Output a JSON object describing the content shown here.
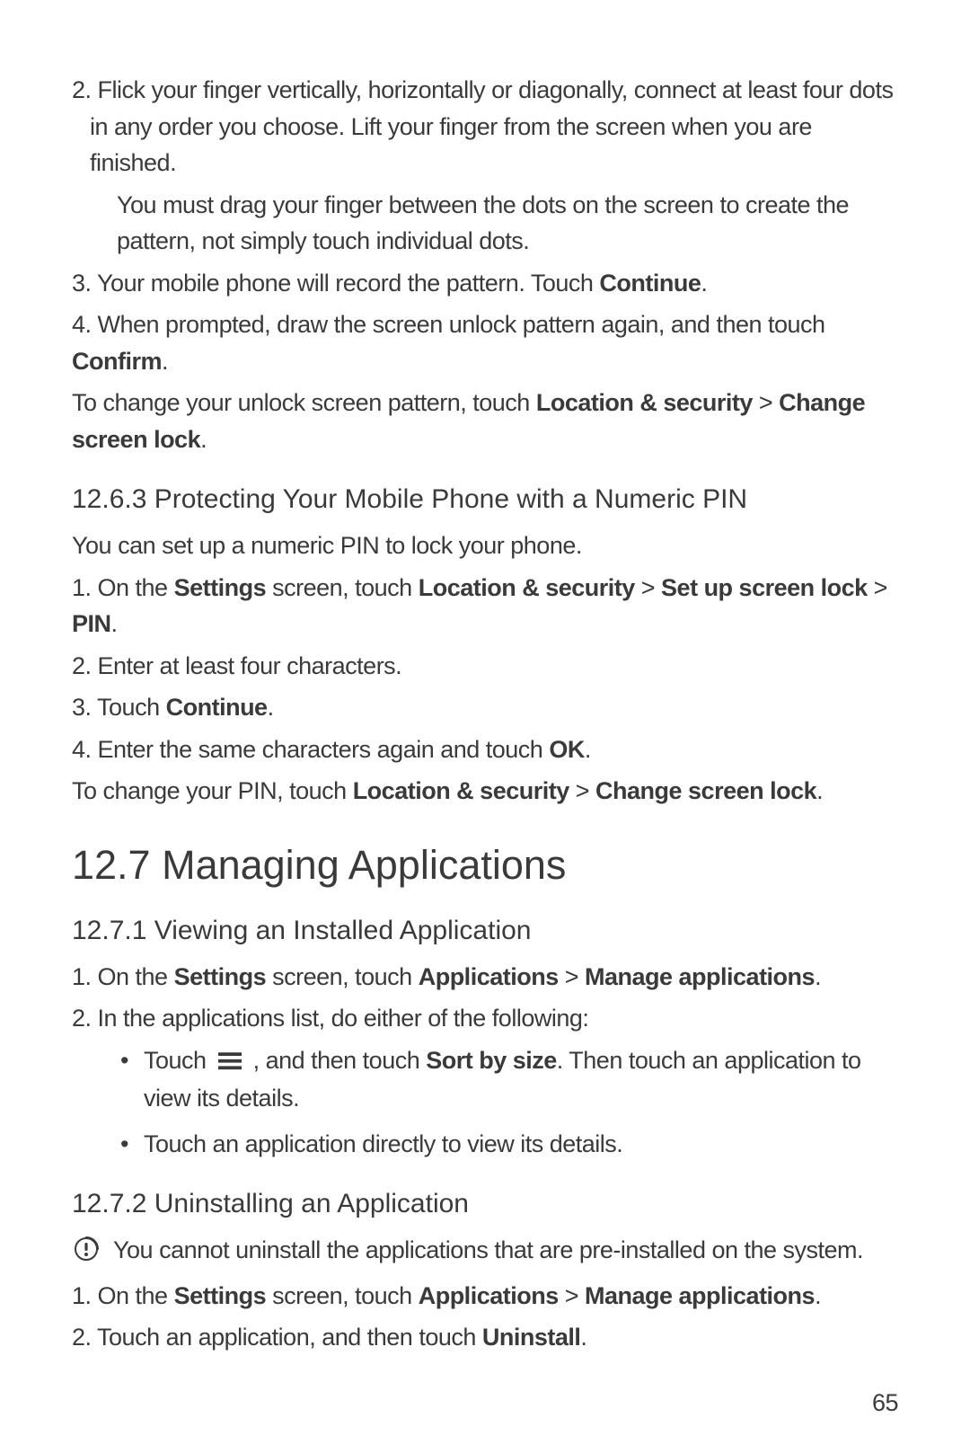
{
  "step2_main": "2. Flick your finger vertically, horizontally or diagonally, connect at least four dots in any order you choose. Lift your finger from the screen when you are finished.",
  "step2_sub": "You must drag your finger between the dots on the screen to create the pattern, not simply touch individual dots.",
  "step3_pre": "3. Your mobile phone will record the pattern. Touch ",
  "step3_bold": "Continue",
  "step3_post": ".",
  "step4_pre": "4. When prompted, draw the screen unlock pattern again, and then touch ",
  "step4_bold": "Confirm",
  "step4_post": ".",
  "change_pattern_pre": "To change your unlock screen pattern, touch ",
  "change_pattern_b1": "Location & security",
  "change_pattern_mid": " > ",
  "change_pattern_b2": "Change screen lock",
  "change_pattern_post": ".",
  "h_1263": "12.6.3  Protecting Your Mobile Phone with a Numeric PIN",
  "pin_intro": "You can set up a numeric PIN to lock your phone.",
  "pin_s1_pre": "1. On the ",
  "pin_s1_b1": "Settings",
  "pin_s1_mid1": " screen, touch ",
  "pin_s1_b2": "Location & security",
  "pin_s1_mid2": " > ",
  "pin_s1_b3": "Set up screen lock",
  "pin_s1_mid3": " > ",
  "pin_s1_b4": "PIN",
  "pin_s1_post": ".",
  "pin_s2": "2. Enter at least four characters.",
  "pin_s3_pre": "3. Touch ",
  "pin_s3_b": "Continue",
  "pin_s3_post": ".",
  "pin_s4_pre": "4. Enter the same characters again and touch ",
  "pin_s4_b": "OK",
  "pin_s4_post": ".",
  "pin_change_pre": "To change your PIN, touch ",
  "pin_change_b1": "Location & security",
  "pin_change_mid": " > ",
  "pin_change_b2": "Change screen lock",
  "pin_change_post": ".",
  "h_127": "12.7  Managing Applications",
  "h_1271": "12.7.1  Viewing an Installed Application",
  "va_s1_pre": "1. On the ",
  "va_s1_b1": "Settings",
  "va_s1_mid1": " screen, touch ",
  "va_s1_b2": "Applications",
  "va_s1_mid2": " > ",
  "va_s1_b3": "Manage applications",
  "va_s1_post": ".",
  "va_s2": "2. In the applications list, do either of the following:",
  "va_bullet1_pre": "Touch ",
  "va_bullet1_mid": " , and then touch ",
  "va_bullet1_b": "Sort by size",
  "va_bullet1_post": ". Then touch an application to view its details.",
  "va_bullet2": "Touch an application directly to view its details.",
  "h_1272": "12.7.2  Uninstalling an Application",
  "un_note": "You cannot uninstall the applications that are pre-installed on the system.",
  "un_s1_pre": "1. On the ",
  "un_s1_b1": "Settings",
  "un_s1_mid1": " screen, touch ",
  "un_s1_b2": "Applications",
  "un_s1_mid2": " > ",
  "un_s1_b3": "Manage applications",
  "un_s1_post": ".",
  "un_s2_pre": "2. Touch an application, and then touch ",
  "un_s2_b": "Uninstall",
  "un_s2_post": ".",
  "page_number": "65"
}
